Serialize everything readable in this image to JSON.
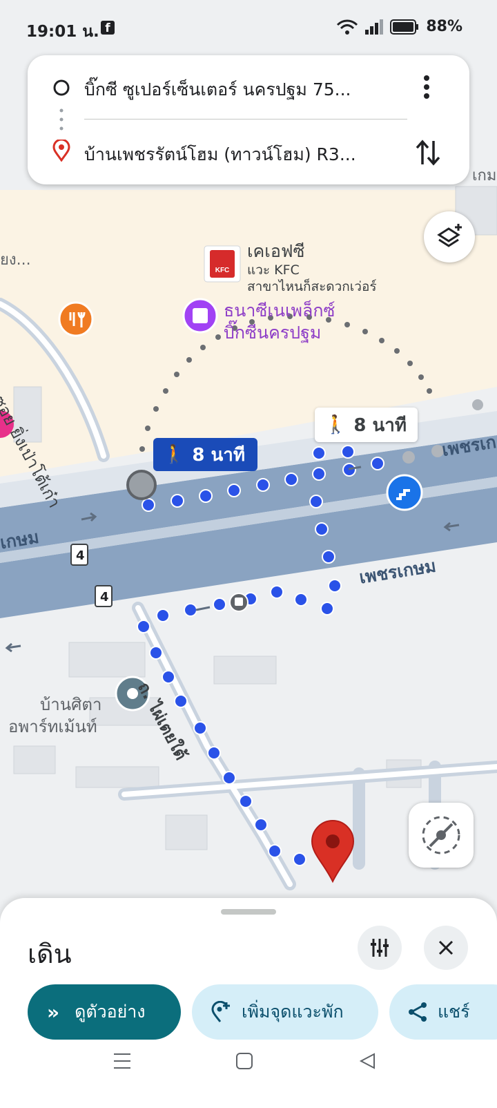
{
  "status_bar": {
    "time": "19:01 น.",
    "battery": "88%"
  },
  "route": {
    "origin": "บิ๊กซี ซูเปอร์เซ็นเตอร์ นครปฐม 75...",
    "destination": "บ้านเพชรรัตน์โฮม (ทาวน์โฮม) R3..."
  },
  "map": {
    "poi_kfc_name": "เคเอฟซี",
    "poi_kfc_sub1": "แวะ KFC",
    "poi_kfc_sub2": "สาขาไหนก็สะดวกเว่อร์",
    "poi_cinema_line1": "ธนาซีเนเพล็กซ์",
    "poi_cinema_line2": "บิ๊กซีนครปฐม",
    "poi_apartment_line1": "บ้านศิตา",
    "poi_apartment_line2": "อพาร์ทเม้นท์",
    "street_soi": "ซอย ยิ่งเป่าโต้เก๋า",
    "street_phet_1": "เพชรเกษม",
    "street_phet_2": "เพชรเกษม",
    "street_phet_3": "เพชรเก",
    "street_phet_left": "เกษม",
    "street_tai": "ถ. ไผ่เตยใต้",
    "left_edge_label": "ยง...",
    "right_edge_label": "เกม",
    "route_shield_1": "4",
    "route_shield_2": "4",
    "walk_time_selected": "8 นาที",
    "walk_time_alt": "8 นาที"
  },
  "sheet": {
    "mode": "เดิน",
    "preview_label": "ดูตัวอย่าง",
    "add_stop_label": "เพิ่มจุดแวะพัก",
    "share_label": "แชร์"
  },
  "colors": {
    "route_blue": "#1a4bb8",
    "dot_blue": "#2a52e8",
    "preview_teal": "#0b6e7c",
    "chip_light": "#d5eef8",
    "pin_red": "#d93025"
  }
}
